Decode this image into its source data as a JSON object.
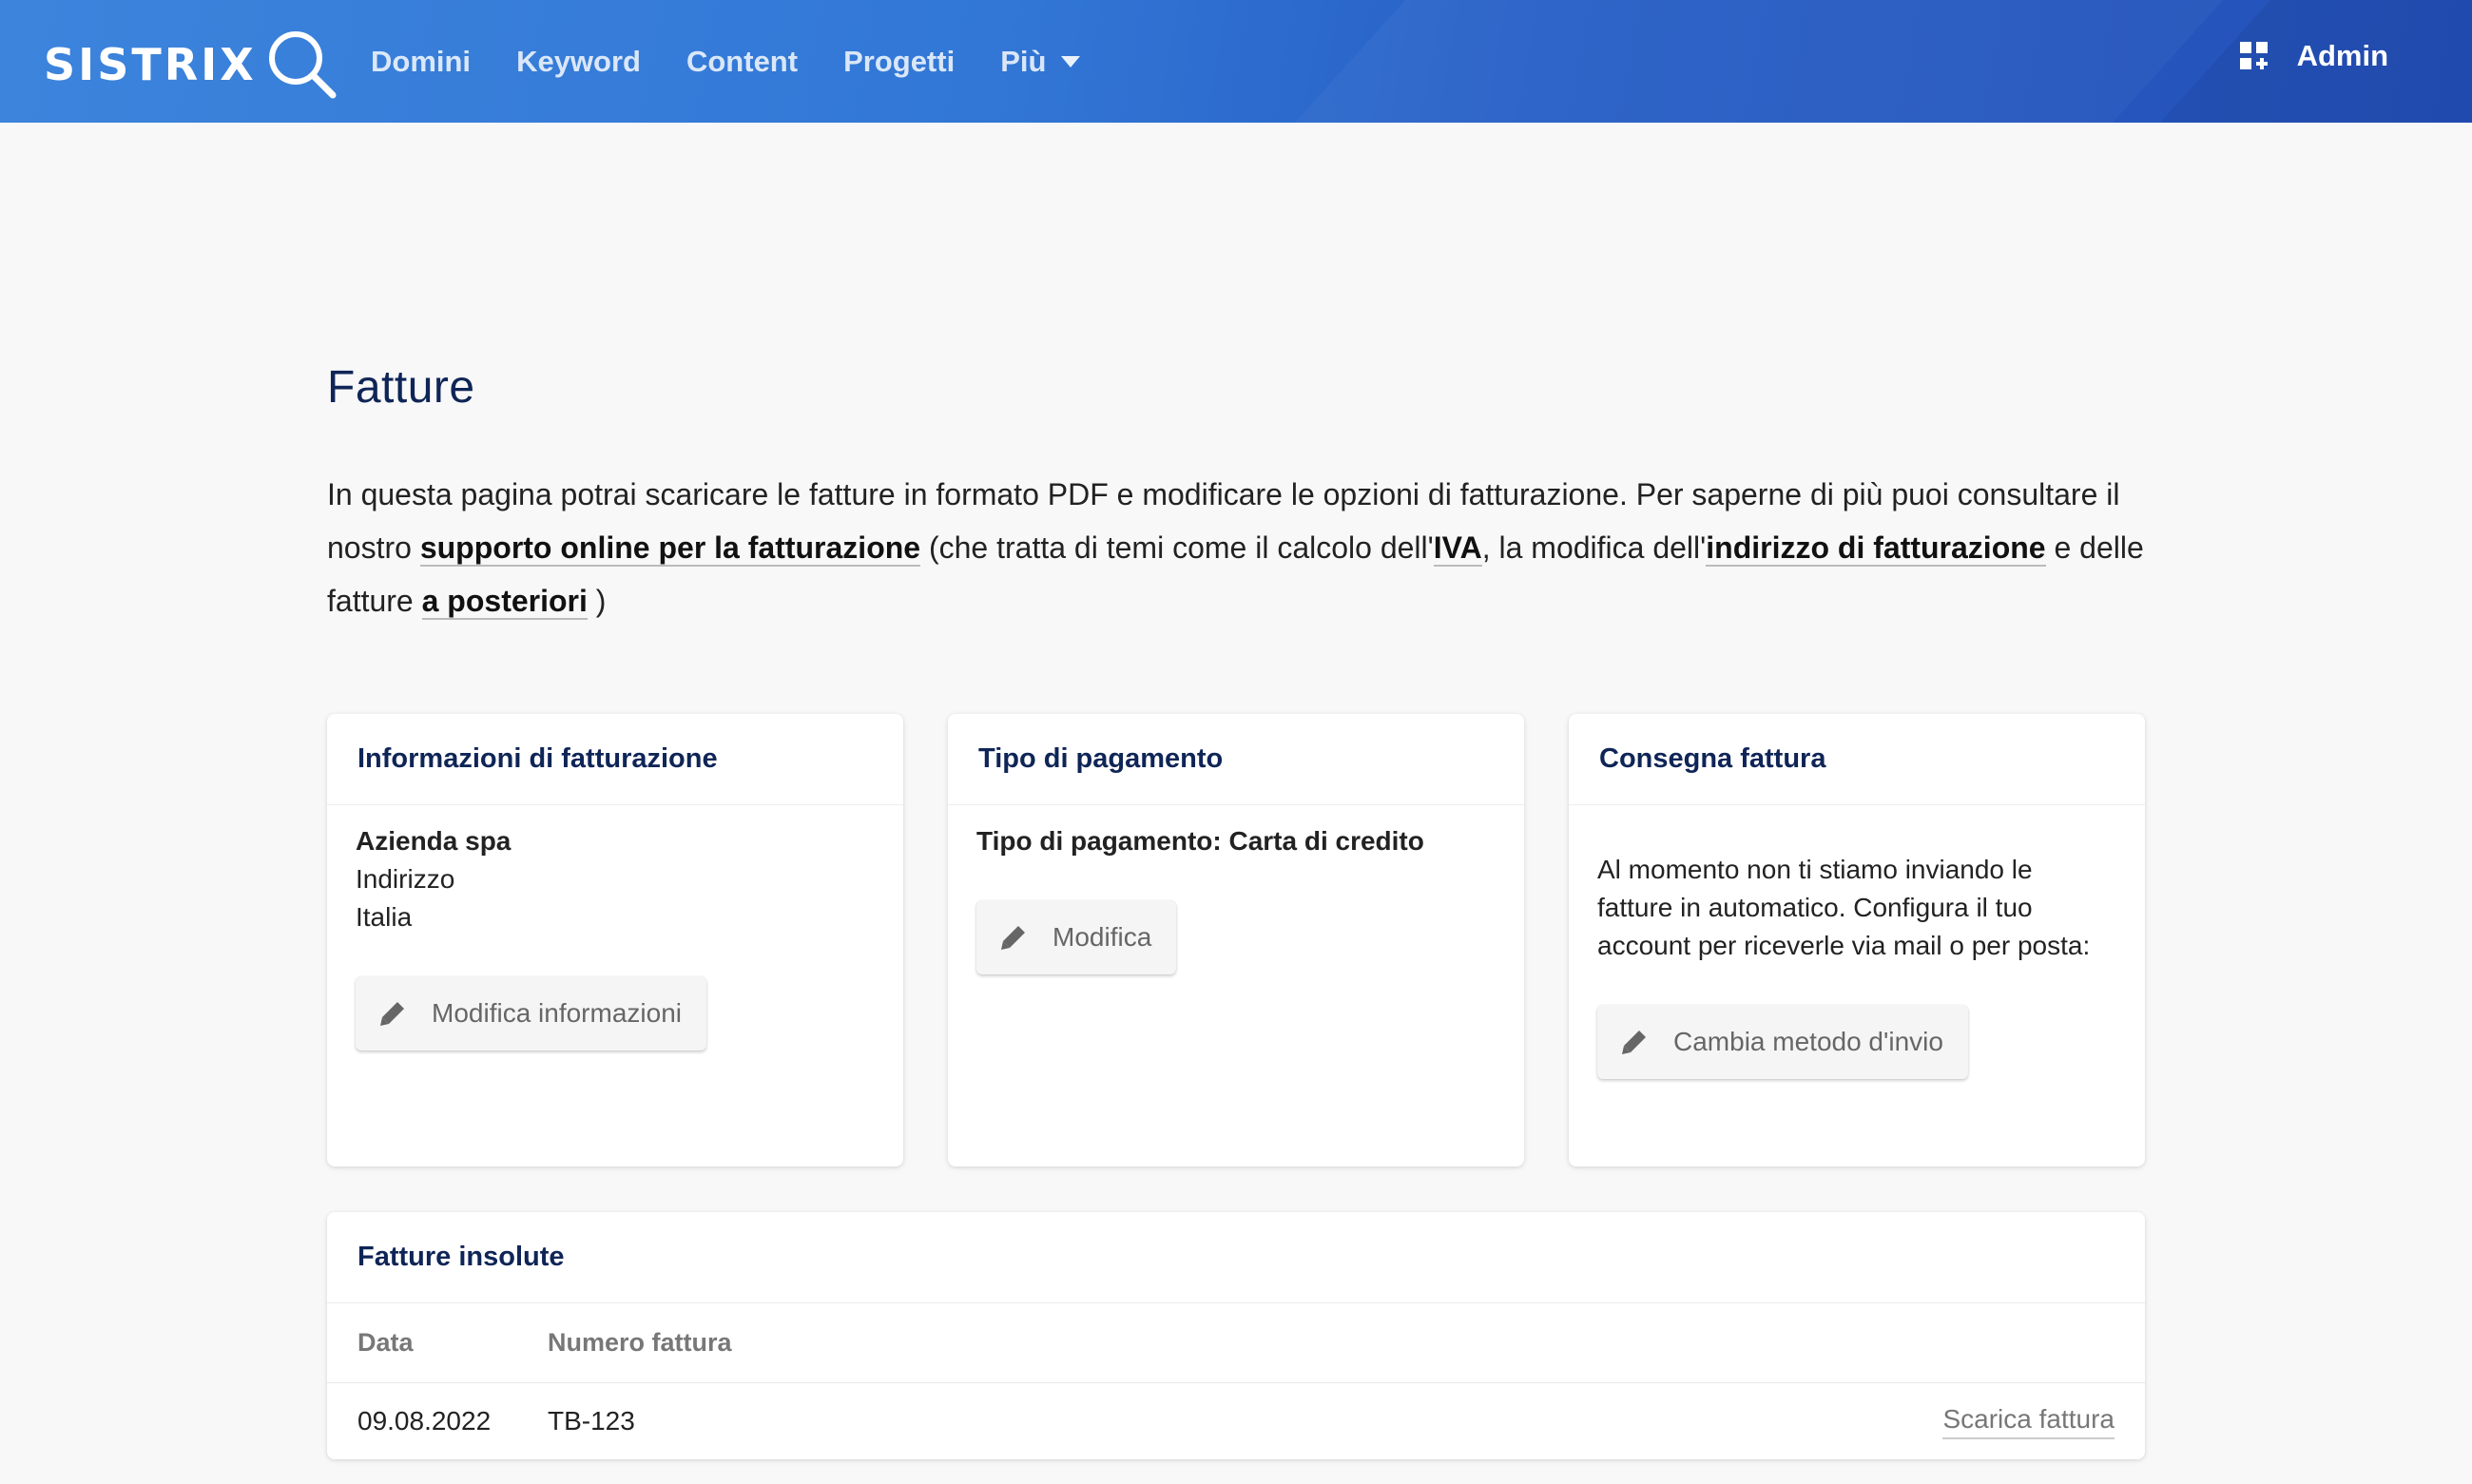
{
  "header": {
    "logo_text": "SISTRIX",
    "nav": [
      {
        "label": "Domini"
      },
      {
        "label": "Keyword"
      },
      {
        "label": "Content"
      },
      {
        "label": "Progetti"
      },
      {
        "label": "Più"
      }
    ],
    "admin_label": "Admin"
  },
  "page": {
    "title": "Fatture",
    "intro": {
      "part1": "In questa pagina potrai scaricare le fatture in formato PDF e modificare le opzioni di fatturazione. Per saperne di più puoi consultare il nostro ",
      "link_support": "supporto online per la fatturazione",
      "part2": " (che tratta di temi come il calcolo dell'",
      "link_iva": "IVA",
      "part3": ", la modifica dell'",
      "link_address": "indirizzo di fatturazione",
      "part4": " e delle fatture ",
      "link_later": "a posteriori",
      "part5": " )"
    }
  },
  "billing_info": {
    "title": "Informazioni di fatturazione",
    "company": "Azienda spa",
    "address": "Indirizzo",
    "country": "Italia",
    "button": "Modifica informazioni"
  },
  "payment": {
    "title": "Tipo di pagamento",
    "type_text": "Tipo di pagamento: Carta di credito",
    "button": "Modifica"
  },
  "delivery": {
    "title": "Consegna fattura",
    "text": "Al momento non ti stiamo inviando le fatture in automatico. Configura il tuo account per riceverle via mail o per posta:",
    "button": "Cambia metodo d'invio"
  },
  "unpaid": {
    "title": "Fatture insolute",
    "columns": {
      "date": "Data",
      "number": "Numero fattura"
    },
    "rows": [
      {
        "date": "09.08.2022",
        "number": "TB-123",
        "action": "Scarica fattura"
      }
    ]
  },
  "colors": {
    "header_blue": "#3277d6",
    "heading_navy": "#0f2557"
  }
}
